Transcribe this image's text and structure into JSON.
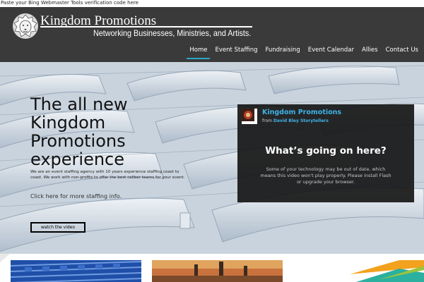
{
  "top_notice": "Paste your Bing Webmaster Tools verification code here",
  "header": {
    "brand": "Kingdom Promotions",
    "tagline": "Networking Businesses, Ministries, and Artists.",
    "logo_icon": "lion-icon"
  },
  "nav": {
    "items": [
      {
        "label": "Home",
        "active": true
      },
      {
        "label": "Event Staffing"
      },
      {
        "label": "Fundraising"
      },
      {
        "label": "Event Calendar"
      },
      {
        "label": "Allies"
      },
      {
        "label": "Contact Us"
      }
    ],
    "active_color": "#2aa7c7"
  },
  "hero": {
    "title": "The all new Kingdom Promotions experience",
    "body": "We are an event staffing agency with 10 years experience staffing coast to coast. We work with non-profits to offer the best caliber teams for your event.",
    "link": "Click here for more staffing info.",
    "button": "watch the video"
  },
  "video": {
    "title": "Kingdom Promotions",
    "from_prefix": "from",
    "from_author": "David Bley Storytellers",
    "heading": "What’s going on here?",
    "message": "Some of your technology may be out of date, which means this video won't play properly. Please install Flash or upgrade your browser.",
    "accent": "#3fb3e8"
  },
  "colors": {
    "header_bg": "#3a3a3a",
    "video_bg": "#161616"
  }
}
